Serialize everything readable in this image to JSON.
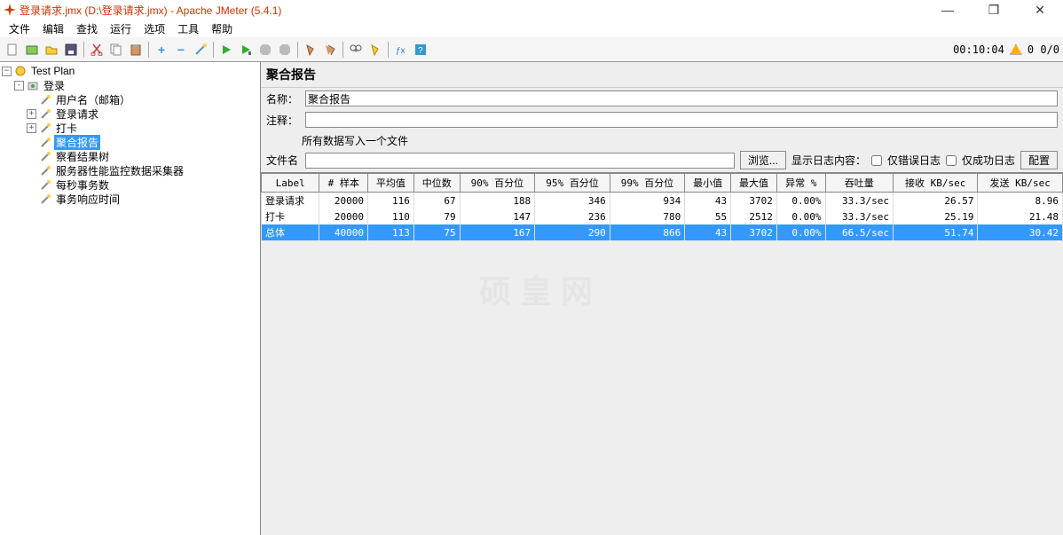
{
  "window": {
    "title": "登录请求.jmx (D:\\登录请求.jmx) - Apache JMeter (5.4.1)"
  },
  "menu": [
    "文件",
    "编辑",
    "查找",
    "运行",
    "选项",
    "工具",
    "帮助"
  ],
  "toolbar_status": {
    "time": "00:10:04",
    "counter": "0 0/0"
  },
  "tree": {
    "root": "Test Plan",
    "nodes": [
      {
        "label": "登录",
        "depth": 1,
        "expand": "-"
      },
      {
        "label": "用户名（邮箱）",
        "depth": 2,
        "expand": ""
      },
      {
        "label": "登录请求",
        "depth": 2,
        "expand": "+"
      },
      {
        "label": "打卡",
        "depth": 2,
        "expand": "+"
      },
      {
        "label": "聚合报告",
        "depth": 2,
        "expand": "",
        "selected": true
      },
      {
        "label": "察看结果树",
        "depth": 2,
        "expand": ""
      },
      {
        "label": "服务器性能监控数据采集器",
        "depth": 2,
        "expand": ""
      },
      {
        "label": "每秒事务数",
        "depth": 2,
        "expand": ""
      },
      {
        "label": "事务响应时间",
        "depth": 2,
        "expand": ""
      }
    ]
  },
  "report": {
    "title": "聚合报告",
    "name_label": "名称：",
    "name_value": "聚合报告",
    "comment_label": "注释：",
    "write_all_label": "所有数据写入一个文件",
    "filename_label": "文件名",
    "browse_btn": "浏览...",
    "show_log_label": "显示日志内容：",
    "err_only_label": "仅错误日志",
    "success_only_label": "仅成功日志",
    "config_btn": "配置"
  },
  "chart_data": {
    "type": "table",
    "columns": [
      "Label",
      "# 样本",
      "平均值",
      "中位数",
      "90% 百分位",
      "95% 百分位",
      "99% 百分位",
      "最小值",
      "最大值",
      "异常 %",
      "吞吐量",
      "接收 KB/sec",
      "发送 KB/sec"
    ],
    "rows": [
      [
        "登录请求",
        20000,
        116,
        67,
        188,
        346,
        934,
        43,
        3702,
        "0.00%",
        "33.3/sec",
        26.57,
        8.96
      ],
      [
        "打卡",
        20000,
        110,
        79,
        147,
        236,
        780,
        55,
        2512,
        "0.00%",
        "33.3/sec",
        25.19,
        21.48
      ],
      [
        "总体",
        40000,
        113,
        75,
        167,
        290,
        866,
        43,
        3702,
        "0.00%",
        "66.5/sec",
        51.74,
        30.42
      ]
    ],
    "selected_row": 2
  },
  "watermark": "硕 皇 网"
}
